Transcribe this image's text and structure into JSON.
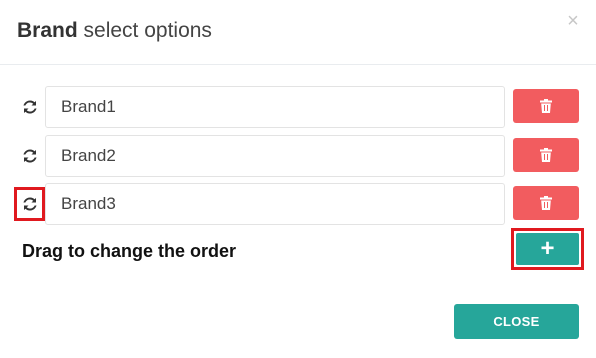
{
  "dialog": {
    "title_bold": "Brand",
    "title_rest": " select options",
    "close_icon": "×"
  },
  "options": [
    {
      "value": "Brand1",
      "handle_icon": "refresh-icon",
      "delete_icon": "trash-icon"
    },
    {
      "value": "Brand2",
      "handle_icon": "refresh-icon",
      "delete_icon": "trash-icon"
    },
    {
      "value": "Brand3",
      "handle_icon": "refresh-icon",
      "delete_icon": "trash-icon"
    }
  ],
  "hint": "Drag to change the order",
  "add_button": {
    "label": "+",
    "color": "#26a69a"
  },
  "delete_button": {
    "color": "#f25c5f"
  },
  "footer": {
    "close_label": "CLOSE"
  },
  "highlight_color": "#e0191f"
}
